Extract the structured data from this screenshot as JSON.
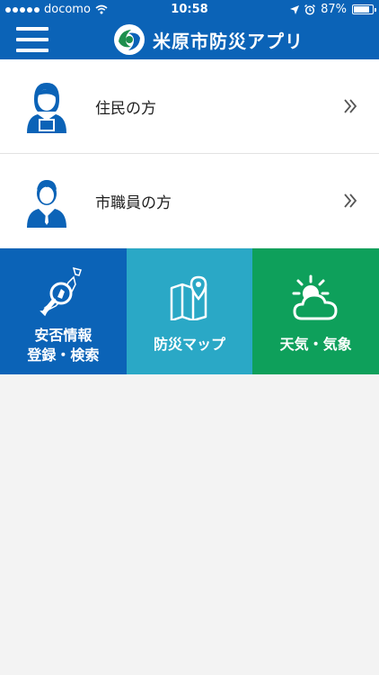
{
  "status_bar": {
    "carrier": "docomo",
    "time": "10:58",
    "battery_percent": "87%",
    "battery_level": 0.87
  },
  "header": {
    "title": "米原市防災アプリ"
  },
  "rows": [
    {
      "label": "住民の方",
      "icon": "resident-person-icon"
    },
    {
      "label": "市職員の方",
      "icon": "staff-person-icon"
    }
  ],
  "tiles": [
    {
      "line1": "安否情報",
      "line2": "登録・検索",
      "icon": "japan-map-search-icon",
      "color": "#0b63b7"
    },
    {
      "label": "防災マップ",
      "icon": "map-pin-icon",
      "color": "#2aa8c6"
    },
    {
      "label": "天気・気象",
      "icon": "sun-cloud-icon",
      "color": "#0ea05b"
    }
  ],
  "colors": {
    "header_blue": "#0b63b7",
    "icon_blue": "#0b63b7",
    "background": "#f3f3f3"
  }
}
